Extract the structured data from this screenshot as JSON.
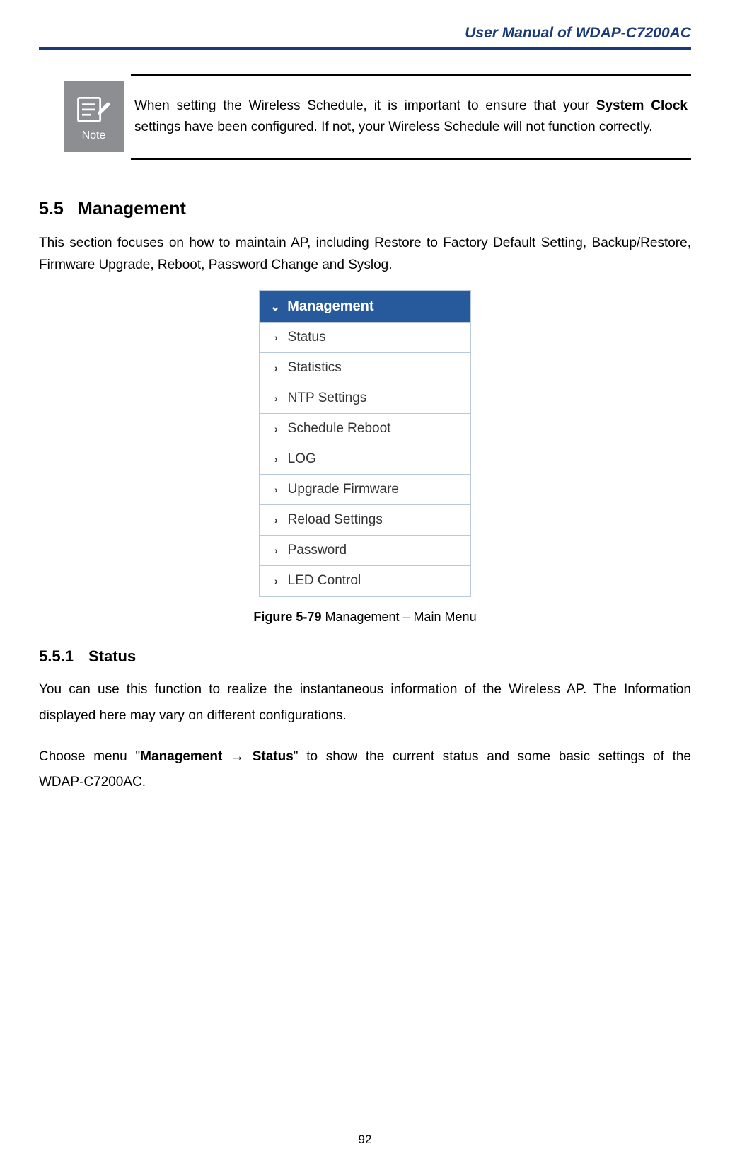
{
  "header": {
    "title": "User Manual of WDAP-C7200AC"
  },
  "note": {
    "icon_label": "Note",
    "text_part1": "When setting the Wireless Schedule, it is important to ensure that your ",
    "text_bold": "System Clock",
    "text_part2": " settings have been configured. If not, your Wireless Schedule will not function correctly."
  },
  "section55": {
    "number": "5.5",
    "title": "Management",
    "intro": "This section focuses on how to maintain AP, including Restore to Factory Default Setting, Backup/Restore, Firmware Upgrade, Reboot, Password Change and Syslog."
  },
  "menu": {
    "header": "Management",
    "items": [
      "Status",
      "Statistics",
      "NTP Settings",
      "Schedule Reboot",
      "LOG",
      "Upgrade Firmware",
      "Reload Settings",
      "Password",
      "LED Control"
    ]
  },
  "figure": {
    "label_bold": "Figure 5-79",
    "label_rest": " Management – Main Menu"
  },
  "section551": {
    "number": "5.5.1",
    "title": "Status",
    "para1": "You can use this function to realize the instantaneous information of the Wireless AP. The Information displayed here may vary on different configurations.",
    "para2_pre": "Choose menu \"",
    "para2_bold1": "Management ",
    "para2_arrow": "→",
    "para2_bold2": " Status",
    "para2_post": "\" to show the current status and some basic settings of the WDAP-C7200AC."
  },
  "page_number": "92"
}
